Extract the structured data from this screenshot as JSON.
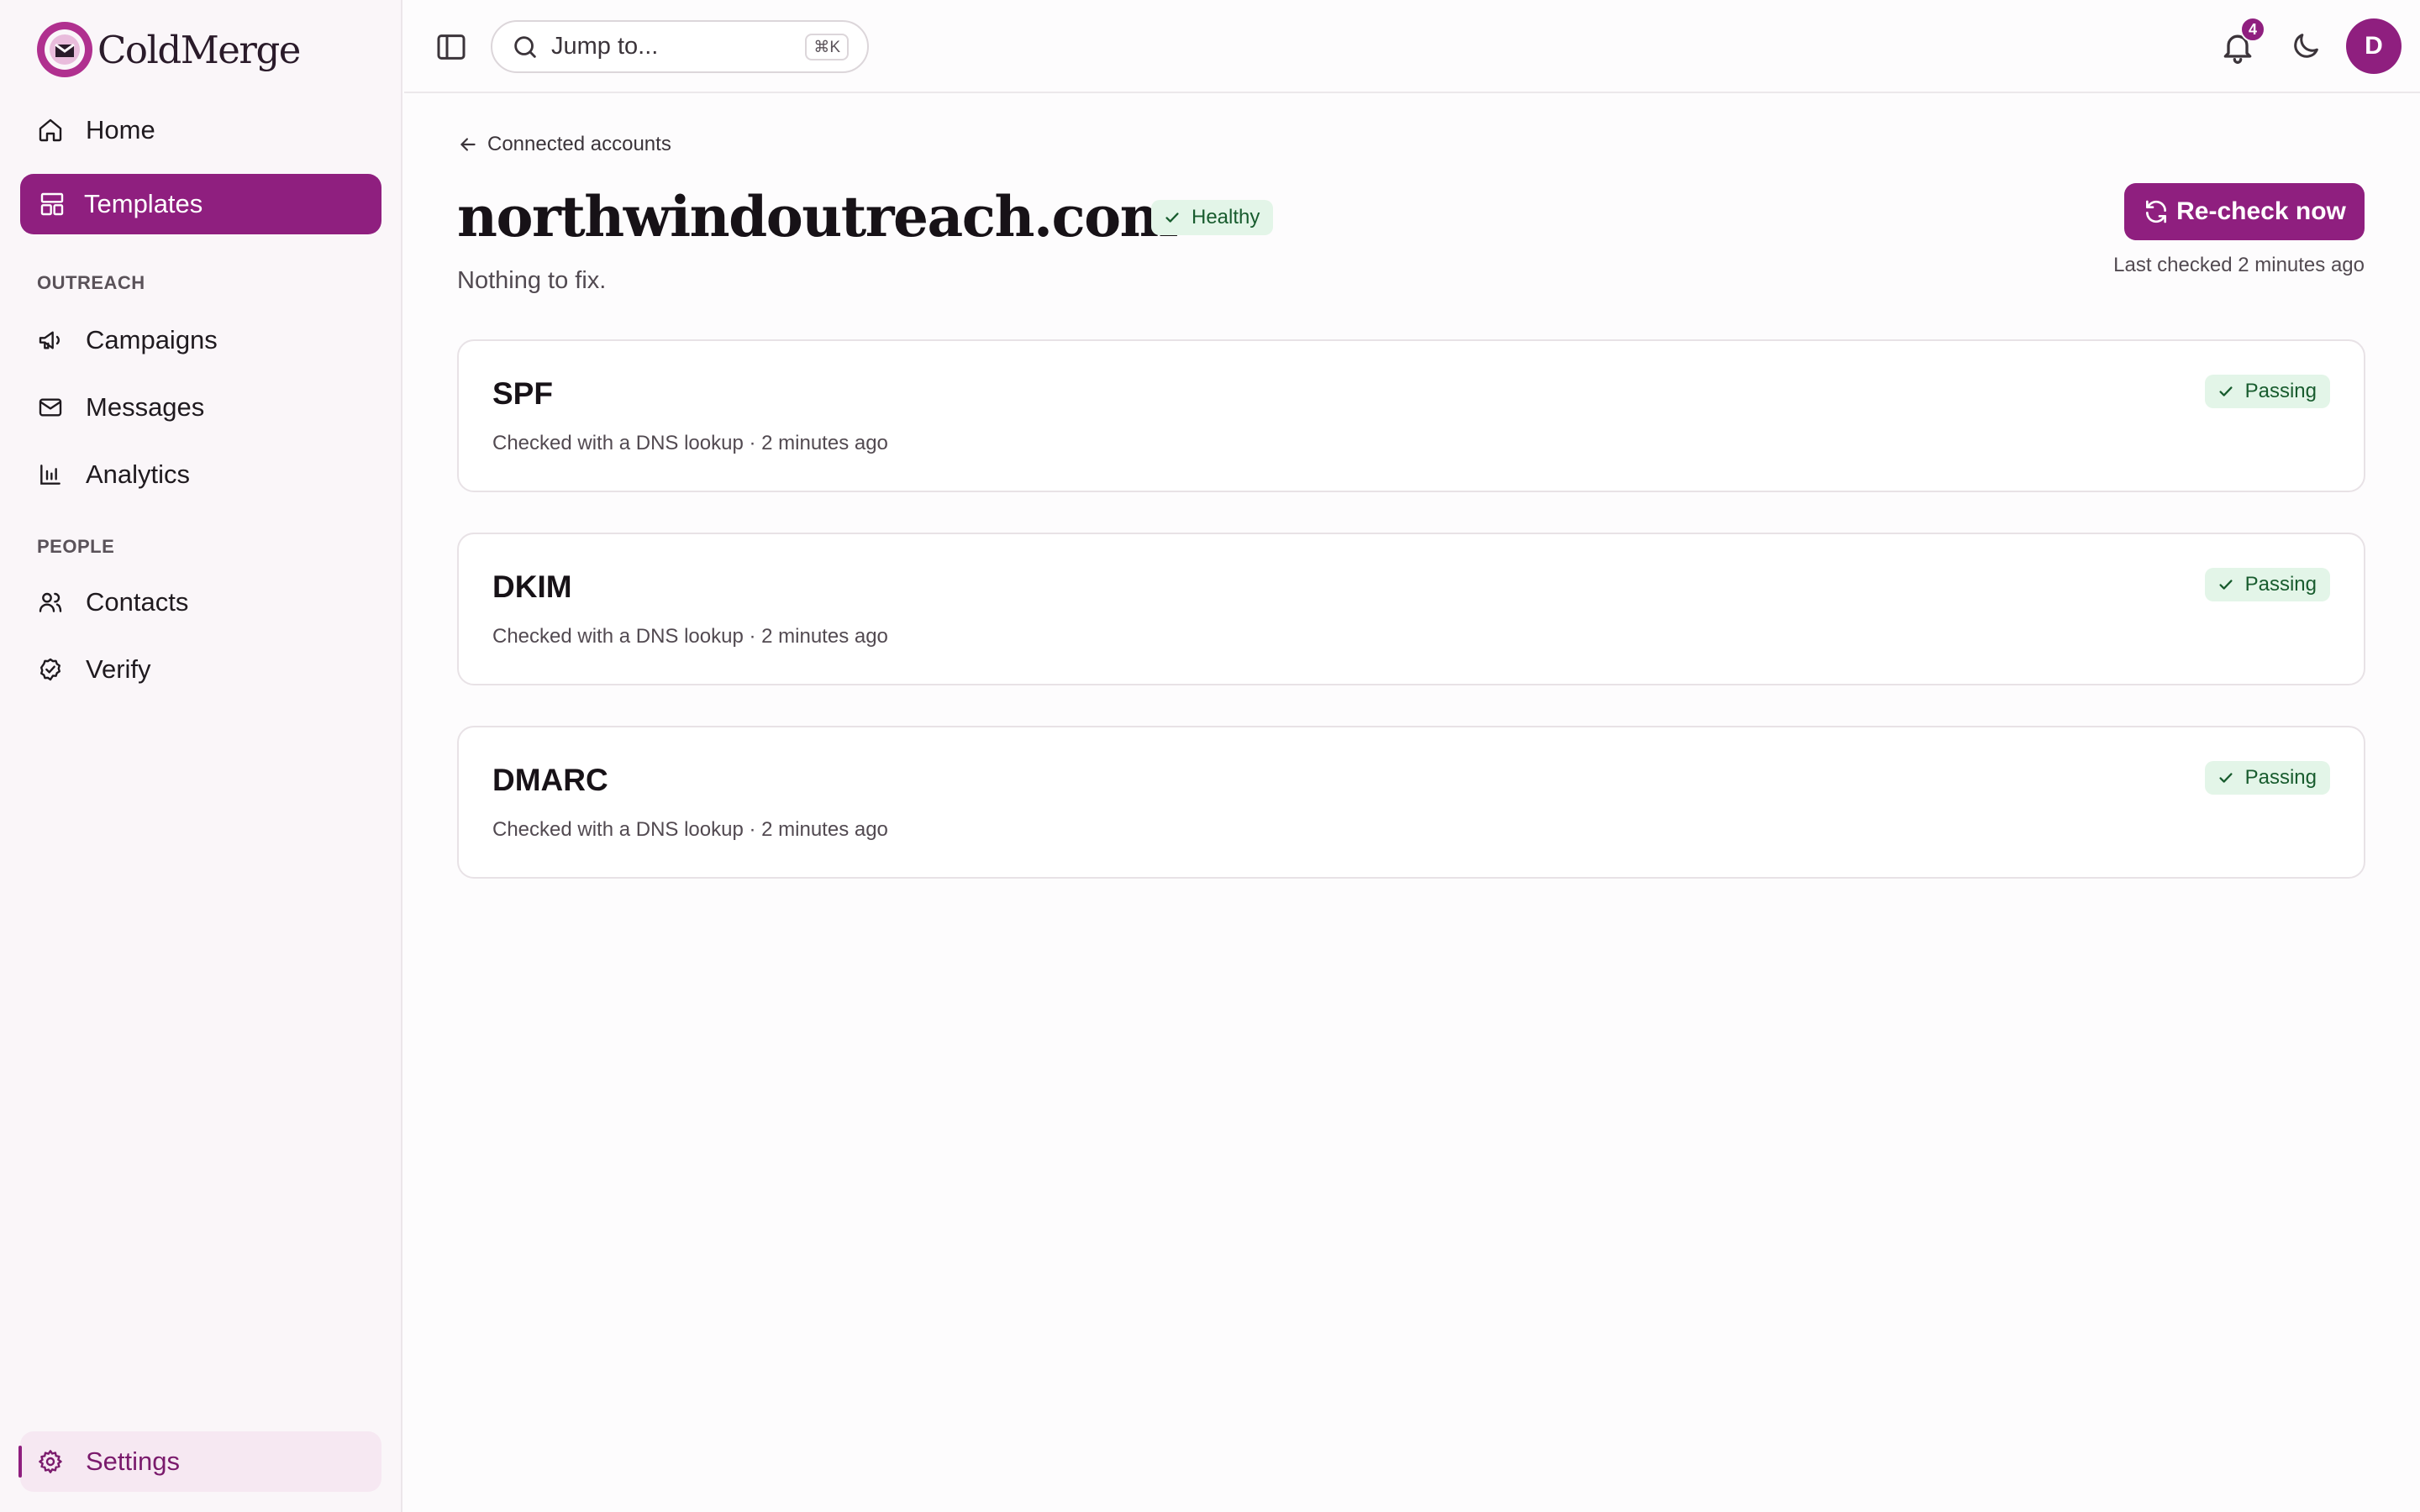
{
  "app": {
    "brand": "ColdMerge"
  },
  "sidebar": {
    "items": [
      {
        "label": "Home",
        "icon": "home-icon"
      },
      {
        "label": "Templates",
        "icon": "templates-icon",
        "active": true
      }
    ],
    "sections": [
      {
        "label": "OUTREACH",
        "items": [
          {
            "label": "Campaigns",
            "icon": "megaphone-icon"
          },
          {
            "label": "Messages",
            "icon": "mail-icon"
          },
          {
            "label": "Analytics",
            "icon": "bar-chart-icon"
          }
        ]
      },
      {
        "label": "PEOPLE",
        "items": [
          {
            "label": "Contacts",
            "icon": "users-icon"
          },
          {
            "label": "Verify",
            "icon": "badge-check-icon"
          }
        ]
      }
    ],
    "settings": {
      "label": "Settings",
      "icon": "gear-icon"
    }
  },
  "topbar": {
    "search_placeholder": "Jump to...",
    "search_shortcut": "⌘K",
    "notification_count": "4",
    "avatar_initial": "D"
  },
  "page": {
    "back_label": "Connected accounts",
    "domain": "northwindoutreach.com",
    "status": "Healthy",
    "subtitle": "Nothing to fix.",
    "recheck_label": "Re-check now",
    "last_checked": "Last checked 2 minutes ago"
  },
  "checks": [
    {
      "name": "SPF",
      "detail": "Checked with a DNS lookup · 2 minutes ago",
      "status": "Passing"
    },
    {
      "name": "DKIM",
      "detail": "Checked with a DNS lookup · 2 minutes ago",
      "status": "Passing"
    },
    {
      "name": "DMARC",
      "detail": "Checked with a DNS lookup · 2 minutes ago",
      "status": "Passing"
    }
  ],
  "colors": {
    "accent": "#8f1f7f",
    "success_bg": "#e3f5e8",
    "success_text": "#185c2e"
  }
}
